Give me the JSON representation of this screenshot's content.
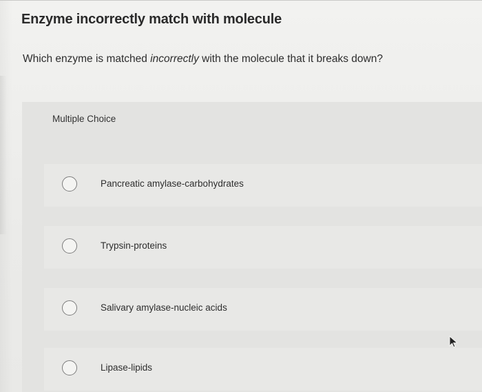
{
  "question": {
    "title": "Enzyme incorrectly match with molecule",
    "prompt_before": "Which enzyme is matched ",
    "prompt_emphasis": "incorrectly",
    "prompt_after": " with the molecule that it breaks down?",
    "type_label": "Multiple Choice"
  },
  "choices": [
    {
      "label": "Pancreatic amylase-carbohydrates"
    },
    {
      "label": "Trypsin-proteins"
    },
    {
      "label": "Salivary amylase-nucleic acids"
    },
    {
      "label": "Lipase-lipids"
    }
  ],
  "icons": {
    "radio": "radio-circle",
    "cursor": "mouse-pointer-arrow"
  }
}
